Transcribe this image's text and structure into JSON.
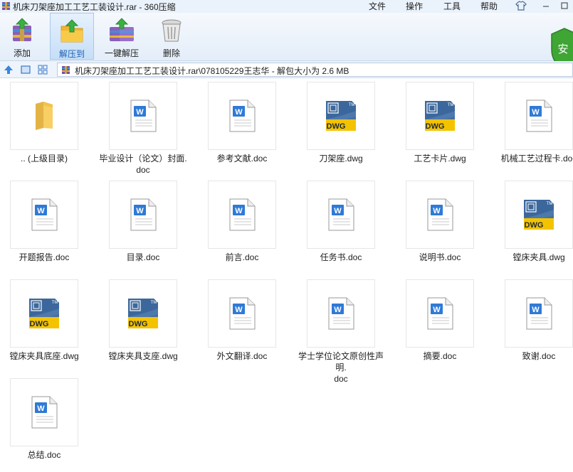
{
  "window": {
    "title": "机床刀架座加工工艺工装设计.rar - 360压缩"
  },
  "menu": {
    "file": "文件",
    "operate": "操作",
    "tools": "工具",
    "help": "帮助"
  },
  "toolbar": {
    "add": "添加",
    "extract_to": "解压到",
    "one_click_extract": "一键解压",
    "delete": "删除"
  },
  "shield": {
    "label": "安"
  },
  "address": {
    "path": "机床刀架座加工工艺工装设计.rar\\078105229王志华 - 解包大小为 2.6 MB"
  },
  "files": [
    {
      "name": ".. (上级目录)",
      "type": "folder"
    },
    {
      "name": "毕业设计（论文）封面.\ndoc",
      "type": "doc"
    },
    {
      "name": "参考文献.doc",
      "type": "doc"
    },
    {
      "name": "刀架座.dwg",
      "type": "dwg"
    },
    {
      "name": "工艺卡片.dwg",
      "type": "dwg"
    },
    {
      "name": "机械工艺过程卡.doc",
      "type": "doc"
    },
    {
      "name": "开题报告.doc",
      "type": "doc"
    },
    {
      "name": "目录.doc",
      "type": "doc"
    },
    {
      "name": "前言.doc",
      "type": "doc"
    },
    {
      "name": "任务书.doc",
      "type": "doc"
    },
    {
      "name": "说明书.doc",
      "type": "doc"
    },
    {
      "name": "镗床夹具.dwg",
      "type": "dwg"
    },
    {
      "name": "镗床夹具底座.dwg",
      "type": "dwg"
    },
    {
      "name": "镗床夹具支座.dwg",
      "type": "dwg"
    },
    {
      "name": "外文翻译.doc",
      "type": "doc"
    },
    {
      "name": "学士学位论文原创性声明.\ndoc",
      "type": "doc"
    },
    {
      "name": "摘要.doc",
      "type": "doc"
    },
    {
      "name": "致谢.doc",
      "type": "doc"
    },
    {
      "name": "总结.doc",
      "type": "doc"
    }
  ],
  "icons": {
    "doc": "word-doc-icon",
    "dwg": "autocad-dwg-icon",
    "folder": "folder-icon",
    "dwg_badge": "DWG",
    "dwg_tm": "TM",
    "doc_badge": "W"
  }
}
